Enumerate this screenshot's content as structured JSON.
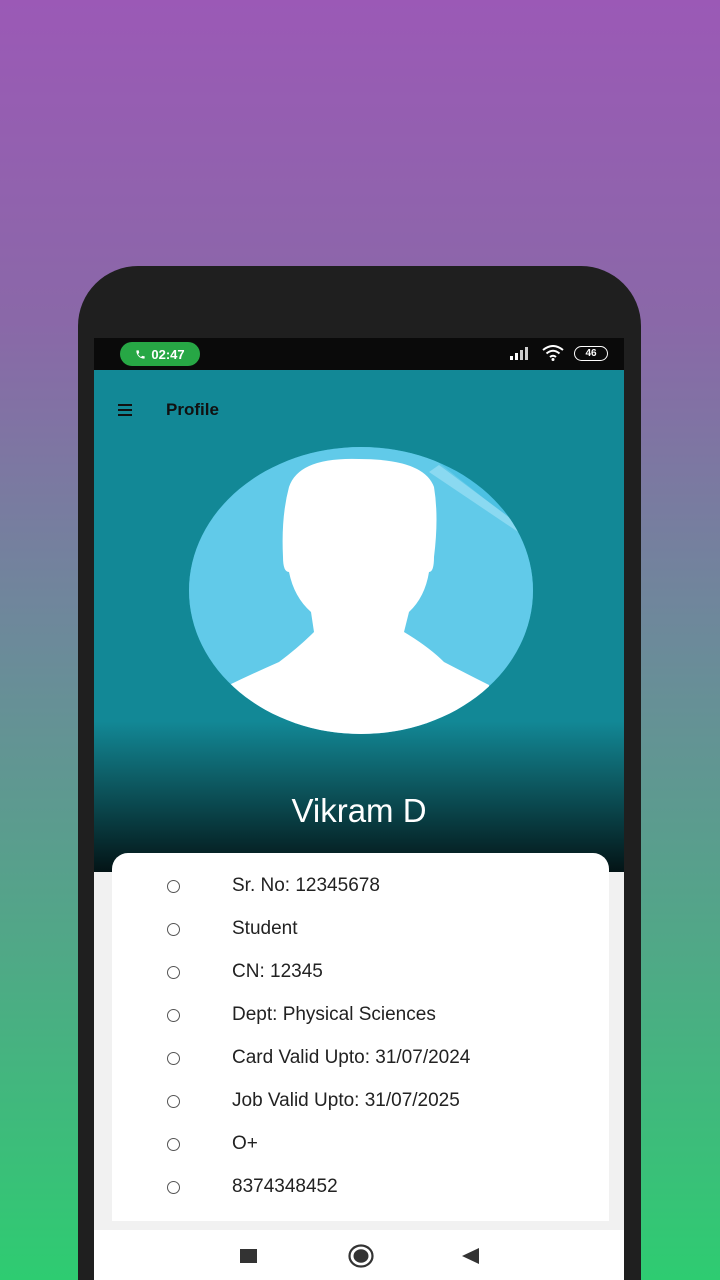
{
  "status_bar": {
    "time": "02:47",
    "battery": "46",
    "icons": [
      "phone-icon",
      "signal-icon",
      "wifi-icon",
      "battery-icon"
    ]
  },
  "header": {
    "title": "Profile",
    "menu_icon": "hamburger-menu-icon"
  },
  "profile": {
    "name": "Vikram D",
    "avatar_icon": "person-silhouette-icon"
  },
  "info": {
    "items": [
      "Sr. No: 12345678",
      "Student",
      "CN: 12345",
      "Dept: Physical Sciences",
      "Card Valid Upto: 31/07/2024",
      "Job Valid Upto: 31/07/2025",
      "O+",
      "8374348452"
    ]
  },
  "nav_bar": {
    "buttons": [
      "recents-square-icon",
      "home-circle-icon",
      "back-triangle-icon"
    ]
  },
  "colors": {
    "header_bg": "#128896",
    "avatar_bg": "#5bc3e4",
    "call_pill": "#27a745"
  }
}
